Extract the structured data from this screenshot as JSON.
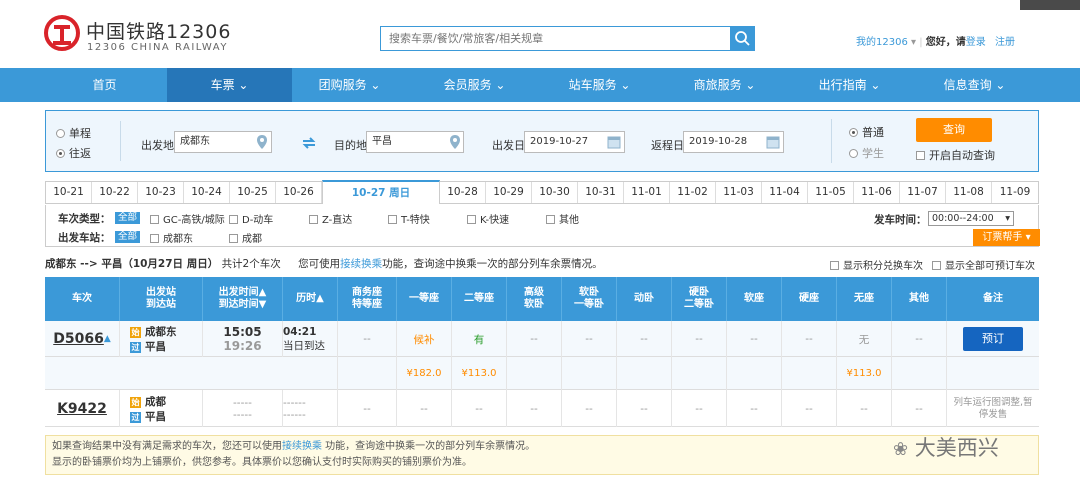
{
  "header": {
    "logo_cn": "中国铁路12306",
    "logo_en": "12306 CHINA RAILWAY",
    "search_placeholder": "搜索车票/餐饮/常旅客/相关规章",
    "my12306": "我的12306",
    "greeting": "您好，请",
    "login": "登录",
    "register": "注册"
  },
  "nav": {
    "items": [
      {
        "label": "首页"
      },
      {
        "label": "车票 ⌄"
      },
      {
        "label": "团购服务 ⌄"
      },
      {
        "label": "会员服务 ⌄"
      },
      {
        "label": "站车服务 ⌄"
      },
      {
        "label": "商旅服务 ⌄"
      },
      {
        "label": "出行指南 ⌄"
      },
      {
        "label": "信息查询 ⌄"
      }
    ]
  },
  "query": {
    "one_way": "单程",
    "round_trip": "往返",
    "from_label": "出发地",
    "from_value": "成都东",
    "to_label": "目的地",
    "to_value": "平昌",
    "depart_label": "出发日",
    "depart_value": "2019-10-27",
    "return_label": "返程日",
    "return_value": "2019-10-28",
    "normal": "普通",
    "student": "学生",
    "query_button": "查询",
    "auto_query": "开启自动查询"
  },
  "date_tabs": [
    "10-21",
    "10-22",
    "10-23",
    "10-24",
    "10-25",
    "10-26",
    "10-27 周日",
    "10-28",
    "10-29",
    "10-30",
    "10-31",
    "11-01",
    "11-02",
    "11-03",
    "11-04",
    "11-05",
    "11-06",
    "11-07",
    "11-08",
    "11-09"
  ],
  "filters": {
    "train_type_label": "车次类型：",
    "station_label": "出发车站：",
    "all": "全部",
    "types": [
      "GC-高铁/城际",
      "D-动车",
      "Z-直达",
      "T-特快",
      "K-快速",
      "其他"
    ],
    "stations": [
      "成都东",
      "成都"
    ],
    "depart_time_label": "发车时间：",
    "depart_time_value": "00:00--24:00",
    "ticket_helper": "订票帮手"
  },
  "summary": {
    "route": "成都东 --> 平昌（10月27日  周日）",
    "count": "共计2个车次",
    "hint_pre": "您可使用",
    "hint_link": "接续换乘",
    "hint_post": "功能，查询途中换乘一次的部分列车余票情况。",
    "points_exchange": "显示积分兑换车次",
    "show_all": "显示全部可预订车次"
  },
  "table": {
    "headers": [
      "车次",
      "出发站\n到达站",
      "出发时间▲\n到达时间▼",
      "历时▲",
      "商务座\n特等座",
      "一等座",
      "二等座",
      "高级\n软卧",
      "软卧\n一等卧",
      "动卧",
      "硬卧\n二等卧",
      "软座",
      "硬座",
      "无座",
      "其他",
      "备注"
    ],
    "rows": [
      {
        "train": "D5066",
        "from": "成都东",
        "to": "平昌",
        "dep": "15:05",
        "arr": "19:26",
        "duration": "04:21",
        "arrive_day": "当日到达",
        "seats": [
          "--",
          "候补",
          "有",
          "--",
          "--",
          "--",
          "--",
          "--",
          "--",
          "无",
          "--"
        ],
        "prices": [
          "",
          "¥182.0",
          "¥113.0",
          "",
          "",
          "",
          "",
          "",
          "",
          "¥113.0",
          ""
        ],
        "action": "预订"
      },
      {
        "train": "K9422",
        "from": "成都",
        "to": "平昌",
        "dep": "-----",
        "arr": "-----",
        "duration": "------",
        "arrive_day": "------",
        "seats": [
          "--",
          "--",
          "--",
          "--",
          "--",
          "--",
          "--",
          "--",
          "--",
          "--",
          "--"
        ],
        "note": "列车运行图调整,暂停发售"
      }
    ]
  },
  "notice": {
    "line1_pre": "如果查询结果中没有满足需求的车次，您还可以使用",
    "line1_link": "接续换乘",
    "line1_post": " 功能，查询途中换乘一次的部分列车余票情况。",
    "line2": "显示的卧铺票价均为上铺票价，供您参考。具体票价以您确认支付时实际购买的铺别票价为准。"
  },
  "watermark": "大美西兴",
  "colors": {
    "brand_blue": "#3b99d8",
    "orange": "#ff8c00",
    "book_blue": "#1565c0"
  }
}
